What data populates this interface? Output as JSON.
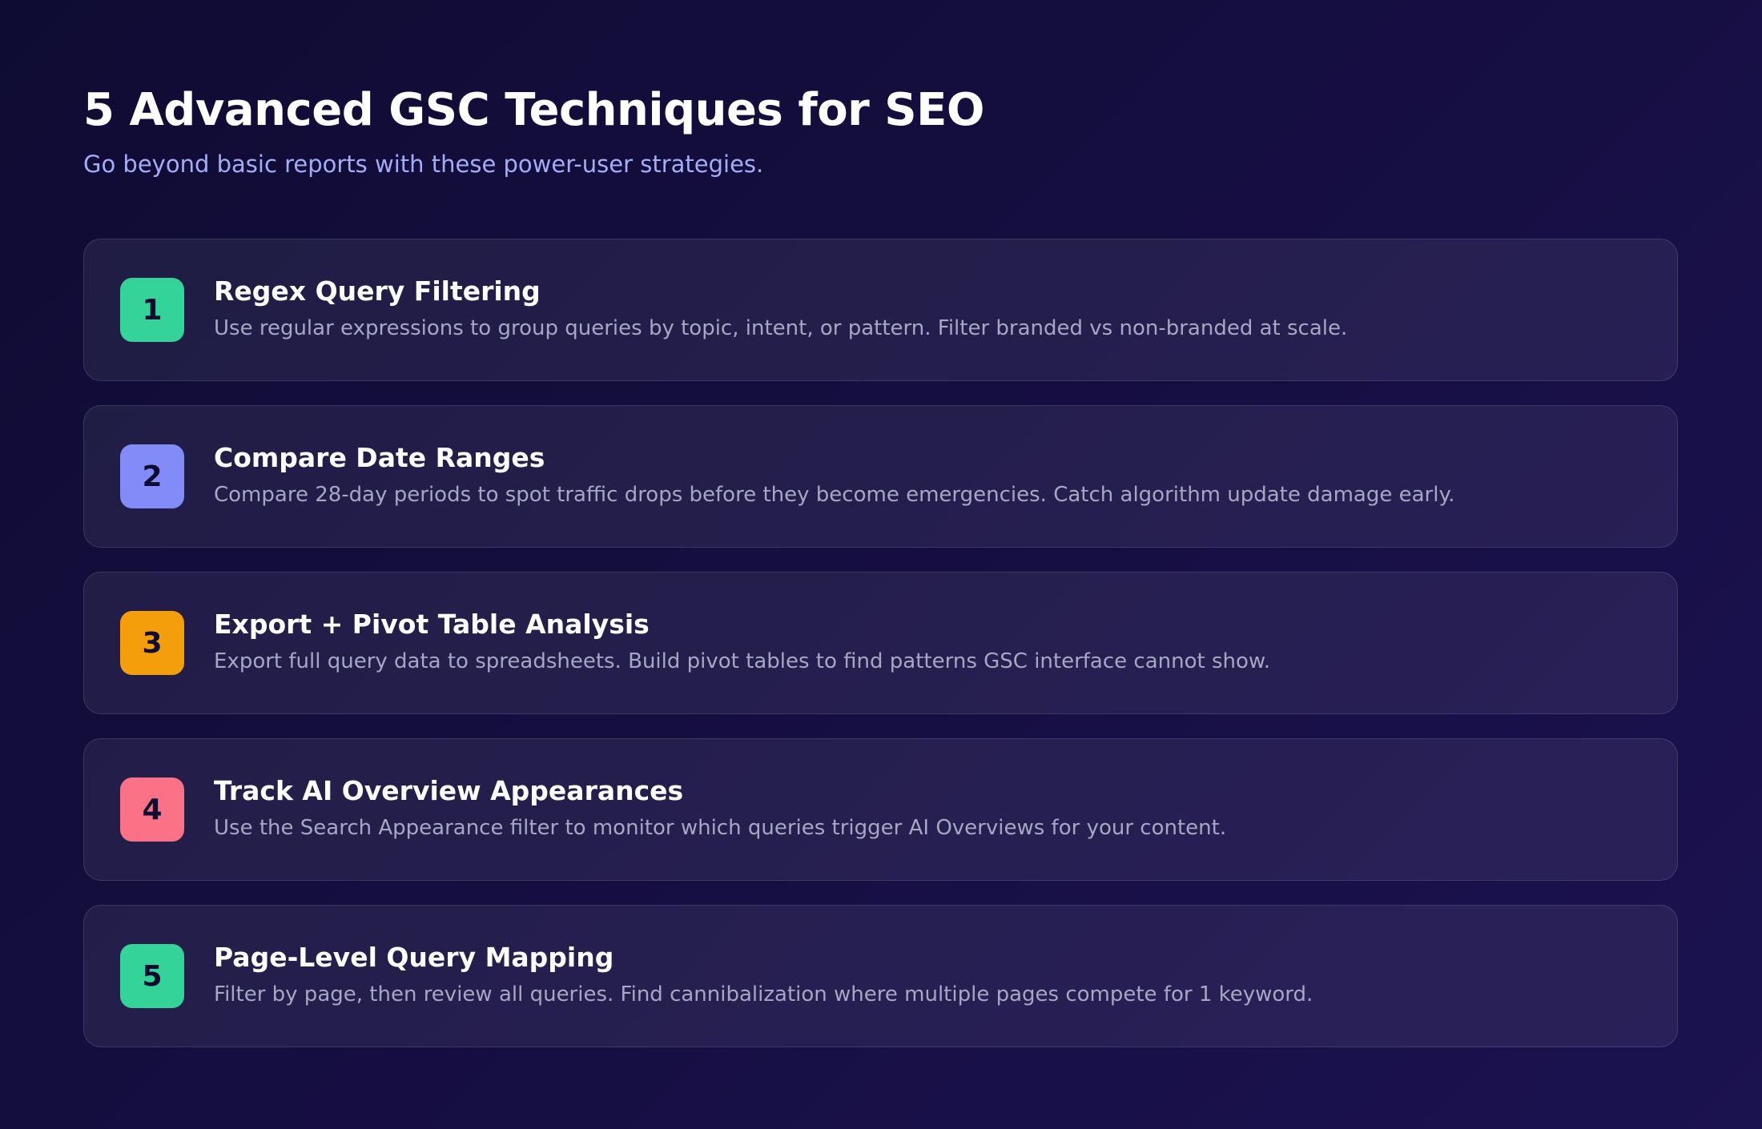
{
  "header": {
    "title": "5 Advanced GSC Techniques for SEO",
    "subtitle": "Go beyond basic reports with these power-user strategies."
  },
  "colors": {
    "green": "#34d399",
    "indigo": "#818cf8",
    "amber": "#f59e0b",
    "pink": "#fb7185"
  },
  "techniques": [
    {
      "number": "1",
      "title": "Regex Query Filtering",
      "description": "Use regular expressions to group queries by topic, intent, or pattern. Filter branded vs non-branded at scale.",
      "badge_color": "#34d399"
    },
    {
      "number": "2",
      "title": "Compare Date Ranges",
      "description": "Compare 28-day periods to spot traffic drops before they become emergencies. Catch algorithm update damage early.",
      "badge_color": "#818cf8"
    },
    {
      "number": "3",
      "title": "Export + Pivot Table Analysis",
      "description": "Export full query data to spreadsheets. Build pivot tables to find patterns GSC interface cannot show.",
      "badge_color": "#f59e0b"
    },
    {
      "number": "4",
      "title": "Track AI Overview Appearances",
      "description": "Use the Search Appearance filter to monitor which queries trigger AI Overviews for your content.",
      "badge_color": "#fb7185"
    },
    {
      "number": "5",
      "title": "Page-Level Query Mapping",
      "description": "Filter by page, then review all queries. Find cannibalization where multiple pages compete for 1 keyword.",
      "badge_color": "#34d399"
    }
  ]
}
